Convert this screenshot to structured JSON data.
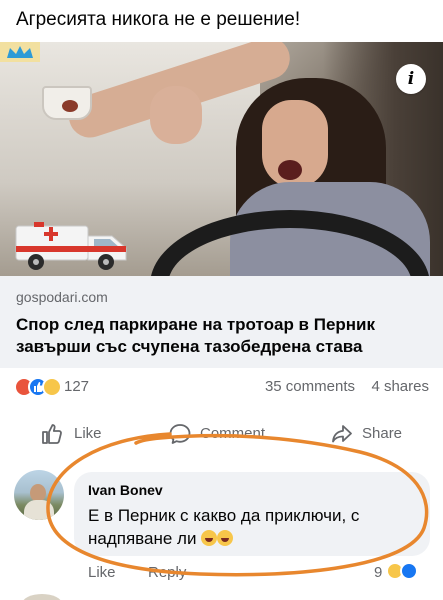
{
  "post": {
    "caption": "Агресията никога не е решение!",
    "info_icon": "i",
    "link": {
      "domain": "gospodari.com",
      "title": "Спор след паркиране на тротоар в Перник завърши със счупена тазобедрена става"
    },
    "stats": {
      "reaction_count": "127",
      "comments": "35 comments",
      "shares": "4 shares"
    },
    "actions": {
      "like": "Like",
      "comment": "Comment",
      "share": "Share"
    }
  },
  "comment": {
    "author": "Ivan Bonev",
    "text": "Е в Перник с какво да приключи, с надпяване ли",
    "like": "Like",
    "reply": "Reply",
    "reaction_count": "9"
  },
  "colors": {
    "annotation": "#e8872e",
    "like_blue": "#1877f2",
    "muted_text": "#65676b",
    "bubble_bg": "#f0f2f5"
  }
}
